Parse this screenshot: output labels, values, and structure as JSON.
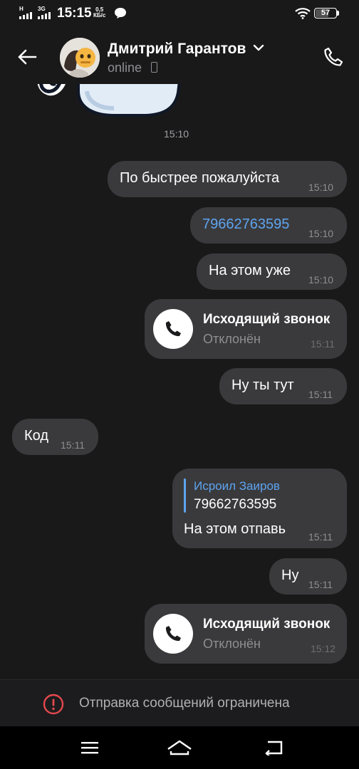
{
  "status_bar": {
    "network1": "H",
    "network2": "3G",
    "time": "15:15",
    "speed_value": "0,5",
    "speed_unit": "КБ/с",
    "battery": "57",
    "icons": [
      "signal-icon",
      "chat-notification-icon",
      "wifi-icon",
      "battery-icon"
    ]
  },
  "header": {
    "contact_name": "Дмитрий Гарантов",
    "status": "online",
    "icons": [
      "back-arrow-icon",
      "chevron-down-icon",
      "mobile-device-icon",
      "phone-call-icon"
    ]
  },
  "chat": {
    "sticker_time": "15:10",
    "messages": [
      {
        "text": "По быстрее пожалуйста",
        "time": "15:10",
        "side": "out"
      },
      {
        "text": "79662763595",
        "time": "15:10",
        "side": "out",
        "link": true
      },
      {
        "text": "На этом уже",
        "time": "15:10",
        "side": "out"
      },
      {
        "call_title": "Исходящий звонок",
        "call_status": "Отклонён",
        "time": "15:11",
        "side": "out"
      },
      {
        "text": "Ну ты тут",
        "time": "15:11",
        "side": "out"
      },
      {
        "text": "Код",
        "time": "15:11",
        "side": "in"
      },
      {
        "reply_author": "Исроил Заиров",
        "reply_text": "79662763595",
        "text": "На этом отпавь",
        "time": "15:11",
        "side": "out"
      },
      {
        "text": "Ну",
        "time": "15:11",
        "side": "out"
      },
      {
        "call_title": "Исходящий звонок",
        "call_status": "Отклонён",
        "time": "15:12",
        "side": "out"
      }
    ]
  },
  "restriction": {
    "text": "Отправка сообщений ограничена",
    "icon": "alert-circle-icon",
    "color": "#e5484d"
  },
  "colors": {
    "background": "#19191a",
    "bubble": "#3a3a3c",
    "link": "#5ea4f0"
  },
  "navigation": {
    "icons": [
      "menu-icon",
      "home-icon",
      "back-icon"
    ]
  }
}
